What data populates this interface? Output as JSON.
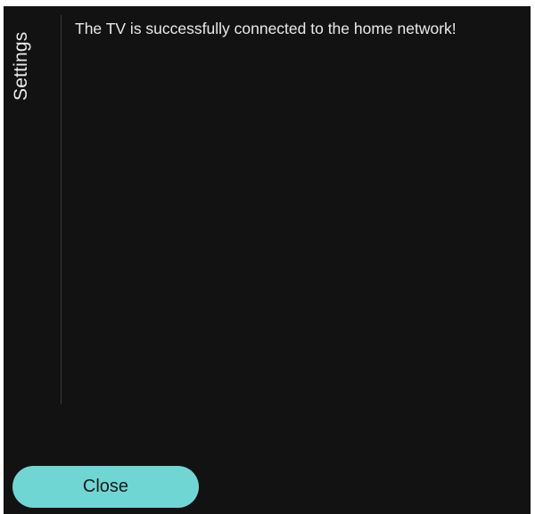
{
  "sidebar": {
    "title": "Settings"
  },
  "main": {
    "message": "The TV is successfully connected to the home network!"
  },
  "footer": {
    "close_label": "Close"
  },
  "colors": {
    "background": "#121212",
    "text": "#eaeaea",
    "button": "#6fd6d4",
    "button_text": "#1a1a1a",
    "divider": "#3a3a3a"
  }
}
